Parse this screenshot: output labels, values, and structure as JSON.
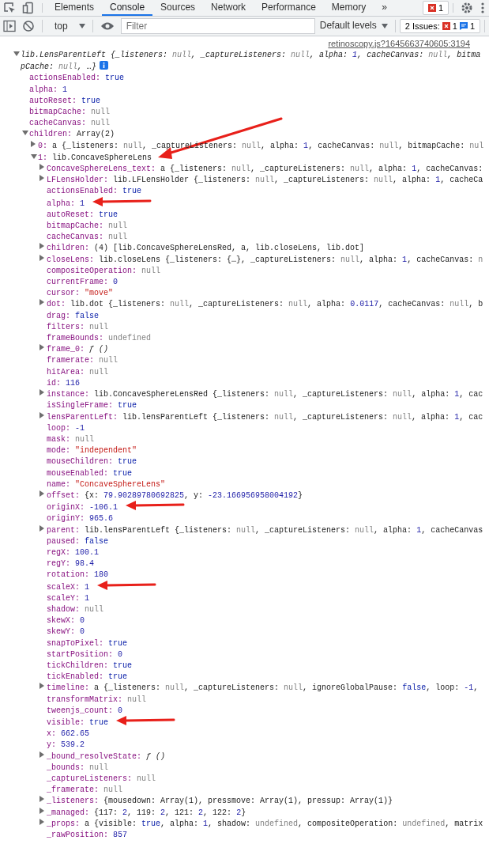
{
  "tabs": [
    {
      "label": "Elements",
      "selected": false
    },
    {
      "label": "Console",
      "selected": true
    },
    {
      "label": "Sources",
      "selected": false
    },
    {
      "label": "Network",
      "selected": false
    },
    {
      "label": "Performance",
      "selected": false
    },
    {
      "label": "Memory",
      "selected": false
    }
  ],
  "more_tabs": "»",
  "error_badge": {
    "count": "1"
  },
  "console_toolbar": {
    "context": "top",
    "filter_placeholder": "Filter",
    "levels": "Default levels",
    "issues": {
      "label": "2 Issues:",
      "errors": "1",
      "infos": "1"
    }
  },
  "source_link": "retinoscopy.js?1645663740605:3194",
  "root": {
    "expanded": true,
    "info_badge": true,
    "preview_lines": [
      [
        {
          "text": "lib.LensParentLeft {_listeners: ",
          "kind": "plain"
        },
        {
          "text": "null",
          "kind": "null"
        },
        {
          "text": ", _captureListeners: ",
          "kind": "plain"
        },
        {
          "text": "null",
          "kind": "null"
        },
        {
          "text": ", alpha: ",
          "kind": "plain"
        },
        {
          "text": "1",
          "kind": "number"
        },
        {
          "text": ", cacheCanvas: ",
          "kind": "plain"
        },
        {
          "text": "null",
          "kind": "null"
        },
        {
          "text": ", bitma",
          "kind": "plain"
        }
      ],
      [
        {
          "text": "pCache: ",
          "kind": "plain"
        },
        {
          "text": "null",
          "kind": "null"
        },
        {
          "text": ", …}",
          "kind": "plain"
        }
      ]
    ],
    "children": [
      {
        "key": "actionsEnabled:",
        "value": "true",
        "kind": "bool"
      },
      {
        "key": "alpha:",
        "value": "1",
        "kind": "number"
      },
      {
        "key": "autoReset:",
        "value": "true",
        "kind": "bool"
      },
      {
        "key": "bitmapCache:",
        "value": "null",
        "kind": "null"
      },
      {
        "key": "cacheCanvas:",
        "value": "null",
        "kind": "null"
      },
      {
        "key": "children:",
        "value": "Array(2)",
        "kind": "plain",
        "expanded": true,
        "children": [
          {
            "key": "0:",
            "expanded": false,
            "parts": [
              {
                "text": "a {_listeners: ",
                "kind": "plain"
              },
              {
                "text": "null",
                "kind": "null"
              },
              {
                "text": ", _captureListeners: ",
                "kind": "plain"
              },
              {
                "text": "null",
                "kind": "null"
              },
              {
                "text": ", alpha: ",
                "kind": "plain"
              },
              {
                "text": "1",
                "kind": "number"
              },
              {
                "text": ", cacheCanvas: ",
                "kind": "plain"
              },
              {
                "text": "null",
                "kind": "null"
              },
              {
                "text": ", bitmapCache: ",
                "kind": "plain"
              },
              {
                "text": "nul",
                "kind": "null"
              }
            ]
          },
          {
            "key": "1:",
            "value": "lib.ConcaveSphereLens",
            "kind": "plain",
            "expanded": true,
            "arrow": true,
            "arrow_slanted": true,
            "children": [
              {
                "key": "ConcaveSphereLens_text:",
                "expanded": false,
                "parts": [
                  {
                    "text": "a {_listeners: ",
                    "kind": "plain"
                  },
                  {
                    "text": "null",
                    "kind": "null"
                  },
                  {
                    "text": ", _captureListeners: ",
                    "kind": "plain"
                  },
                  {
                    "text": "null",
                    "kind": "null"
                  },
                  {
                    "text": ", alpha: ",
                    "kind": "plain"
                  },
                  {
                    "text": "1",
                    "kind": "number"
                  },
                  {
                    "text": ", cacheCanvas:",
                    "kind": "plain"
                  }
                ]
              },
              {
                "key": "LFLensHolder:",
                "expanded": false,
                "parts": [
                  {
                    "text": "lib.LFLensHolder {_listeners: ",
                    "kind": "plain"
                  },
                  {
                    "text": "null",
                    "kind": "null"
                  },
                  {
                    "text": ", _captureListeners: ",
                    "kind": "plain"
                  },
                  {
                    "text": "null",
                    "kind": "null"
                  },
                  {
                    "text": ", alpha: ",
                    "kind": "plain"
                  },
                  {
                    "text": "1",
                    "kind": "number"
                  },
                  {
                    "text": ", cacheCa",
                    "kind": "plain"
                  }
                ]
              },
              {
                "key": "actionsEnabled:",
                "value": "true",
                "kind": "bool"
              },
              {
                "key": "alpha:",
                "value": "1",
                "kind": "number",
                "arrow": true
              },
              {
                "key": "autoReset:",
                "value": "true",
                "kind": "bool"
              },
              {
                "key": "bitmapCache:",
                "value": "null",
                "kind": "null"
              },
              {
                "key": "cacheCanvas:",
                "value": "null",
                "kind": "null"
              },
              {
                "key": "children:",
                "expanded": false,
                "parts": [
                  {
                    "text": "(4) [lib.ConcaveSphereLensRed, a, lib.closeLens, lib.dot]",
                    "kind": "plain"
                  }
                ]
              },
              {
                "key": "closeLens:",
                "expanded": false,
                "parts": [
                  {
                    "text": "lib.closeLens {_listeners: {…}, _captureListeners: ",
                    "kind": "plain"
                  },
                  {
                    "text": "null",
                    "kind": "null"
                  },
                  {
                    "text": ", alpha: ",
                    "kind": "plain"
                  },
                  {
                    "text": "1",
                    "kind": "number"
                  },
                  {
                    "text": ", cacheCanvas: ",
                    "kind": "plain"
                  },
                  {
                    "text": "n",
                    "kind": "null"
                  }
                ]
              },
              {
                "key": "compositeOperation:",
                "value": "null",
                "kind": "null"
              },
              {
                "key": "currentFrame:",
                "value": "0",
                "kind": "number"
              },
              {
                "key": "cursor:",
                "value": "\"move\"",
                "kind": "string"
              },
              {
                "key": "dot:",
                "expanded": false,
                "parts": [
                  {
                    "text": "lib.dot {_listeners: ",
                    "kind": "plain"
                  },
                  {
                    "text": "null",
                    "kind": "null"
                  },
                  {
                    "text": ", _captureListeners: ",
                    "kind": "plain"
                  },
                  {
                    "text": "null",
                    "kind": "null"
                  },
                  {
                    "text": ", alpha: ",
                    "kind": "plain"
                  },
                  {
                    "text": "0.0117",
                    "kind": "number"
                  },
                  {
                    "text": ", cacheCanvas: ",
                    "kind": "plain"
                  },
                  {
                    "text": "null",
                    "kind": "null"
                  },
                  {
                    "text": ", b",
                    "kind": "plain"
                  }
                ]
              },
              {
                "key": "drag:",
                "value": "false",
                "kind": "bool"
              },
              {
                "key": "filters:",
                "value": "null",
                "kind": "null"
              },
              {
                "key": "frameBounds:",
                "value": "undefined",
                "kind": "null"
              },
              {
                "key": "frame_0:",
                "value": "ƒ ()",
                "kind": "func",
                "expanded": false
              },
              {
                "key": "framerate:",
                "value": "null",
                "kind": "null"
              },
              {
                "key": "hitArea:",
                "value": "null",
                "kind": "null"
              },
              {
                "key": "id:",
                "value": "116",
                "kind": "number"
              },
              {
                "key": "instance:",
                "expanded": false,
                "parts": [
                  {
                    "text": "lib.ConcaveSphereLensRed {_listeners: ",
                    "kind": "plain"
                  },
                  {
                    "text": "null",
                    "kind": "null"
                  },
                  {
                    "text": ", _captureListeners: ",
                    "kind": "plain"
                  },
                  {
                    "text": "null",
                    "kind": "null"
                  },
                  {
                    "text": ", alpha: ",
                    "kind": "plain"
                  },
                  {
                    "text": "1",
                    "kind": "number"
                  },
                  {
                    "text": ", cac",
                    "kind": "plain"
                  }
                ]
              },
              {
                "key": "isSingleFrame:",
                "value": "true",
                "kind": "bool"
              },
              {
                "key": "lensParentLeft:",
                "expanded": false,
                "parts": [
                  {
                    "text": "lib.lensParentLeft {_listeners: ",
                    "kind": "plain"
                  },
                  {
                    "text": "null",
                    "kind": "null"
                  },
                  {
                    "text": ", _captureListeners: ",
                    "kind": "plain"
                  },
                  {
                    "text": "null",
                    "kind": "null"
                  },
                  {
                    "text": ", alpha: ",
                    "kind": "plain"
                  },
                  {
                    "text": "1",
                    "kind": "number"
                  },
                  {
                    "text": ", cac",
                    "kind": "plain"
                  }
                ]
              },
              {
                "key": "loop:",
                "value": "-1",
                "kind": "number"
              },
              {
                "key": "mask:",
                "value": "null",
                "kind": "null"
              },
              {
                "key": "mode:",
                "value": "\"independent\"",
                "kind": "string"
              },
              {
                "key": "mouseChildren:",
                "value": "true",
                "kind": "bool"
              },
              {
                "key": "mouseEnabled:",
                "value": "true",
                "kind": "bool"
              },
              {
                "key": "name:",
                "value": "\"ConcaveSphereLens\"",
                "kind": "string"
              },
              {
                "key": "offset:",
                "expanded": false,
                "parts": [
                  {
                    "text": "{x: ",
                    "kind": "plain"
                  },
                  {
                    "text": "79.90289780692825",
                    "kind": "number"
                  },
                  {
                    "text": ", y: ",
                    "kind": "plain"
                  },
                  {
                    "text": "-23.166956958004192",
                    "kind": "number"
                  },
                  {
                    "text": "}",
                    "kind": "plain"
                  }
                ]
              },
              {
                "key": "originX:",
                "value": "-106.1",
                "kind": "number",
                "arrow": true
              },
              {
                "key": "originY:",
                "value": "965.6",
                "kind": "number"
              },
              {
                "key": "parent:",
                "expanded": false,
                "parts": [
                  {
                    "text": "lib.lensParentLeft {_listeners: ",
                    "kind": "plain"
                  },
                  {
                    "text": "null",
                    "kind": "null"
                  },
                  {
                    "text": ", _captureListeners: ",
                    "kind": "plain"
                  },
                  {
                    "text": "null",
                    "kind": "null"
                  },
                  {
                    "text": ", alpha: ",
                    "kind": "plain"
                  },
                  {
                    "text": "1",
                    "kind": "number"
                  },
                  {
                    "text": ", cacheCanvas",
                    "kind": "plain"
                  }
                ]
              },
              {
                "key": "paused:",
                "value": "false",
                "kind": "bool"
              },
              {
                "key": "regX:",
                "value": "100.1",
                "kind": "number"
              },
              {
                "key": "regY:",
                "value": "98.4",
                "kind": "number"
              },
              {
                "key": "rotation:",
                "value": "180",
                "kind": "number"
              },
              {
                "key": "scaleX:",
                "value": "1",
                "kind": "number",
                "arrow": true
              },
              {
                "key": "scaleY:",
                "value": "1",
                "kind": "number"
              },
              {
                "key": "shadow:",
                "value": "null",
                "kind": "null"
              },
              {
                "key": "skewX:",
                "value": "0",
                "kind": "number"
              },
              {
                "key": "skewY:",
                "value": "0",
                "kind": "number"
              },
              {
                "key": "snapToPixel:",
                "value": "true",
                "kind": "bool"
              },
              {
                "key": "startPosition:",
                "value": "0",
                "kind": "number"
              },
              {
                "key": "tickChildren:",
                "value": "true",
                "kind": "bool"
              },
              {
                "key": "tickEnabled:",
                "value": "true",
                "kind": "bool"
              },
              {
                "key": "timeline:",
                "expanded": false,
                "parts": [
                  {
                    "text": "a {_listeners: ",
                    "kind": "plain"
                  },
                  {
                    "text": "null",
                    "kind": "null"
                  },
                  {
                    "text": ", _captureListeners: ",
                    "kind": "plain"
                  },
                  {
                    "text": "null",
                    "kind": "null"
                  },
                  {
                    "text": ", ignoreGlobalPause: ",
                    "kind": "plain"
                  },
                  {
                    "text": "false",
                    "kind": "bool"
                  },
                  {
                    "text": ", loop: ",
                    "kind": "plain"
                  },
                  {
                    "text": "-1",
                    "kind": "number"
                  },
                  {
                    "text": ",",
                    "kind": "plain"
                  }
                ]
              },
              {
                "key": "transformMatrix:",
                "value": "null",
                "kind": "null"
              },
              {
                "key": "tweenjs_count:",
                "value": "0",
                "kind": "number"
              },
              {
                "key": "visible:",
                "value": "true",
                "kind": "bool",
                "arrow": true
              },
              {
                "key": "x:",
                "value": "662.65",
                "kind": "number"
              },
              {
                "key": "y:",
                "value": "539.2",
                "kind": "number"
              },
              {
                "key": "_bound_resolveState:",
                "value": "ƒ ()",
                "kind": "func",
                "expanded": false
              },
              {
                "key": "_bounds:",
                "value": "null",
                "kind": "null"
              },
              {
                "key": "_captureListeners:",
                "value": "null",
                "kind": "null"
              },
              {
                "key": "_framerate:",
                "value": "null",
                "kind": "null"
              },
              {
                "key": "_listeners:",
                "expanded": false,
                "parts": [
                  {
                    "text": "{mousedown: Array(1), pressmove: Array(1), pressup: Array(1)}",
                    "kind": "plain"
                  }
                ]
              },
              {
                "key": "_managed:",
                "expanded": false,
                "parts": [
                  {
                    "text": "{117: ",
                    "kind": "plain"
                  },
                  {
                    "text": "2",
                    "kind": "number"
                  },
                  {
                    "text": ", 119: ",
                    "kind": "plain"
                  },
                  {
                    "text": "2",
                    "kind": "number"
                  },
                  {
                    "text": ", 121: ",
                    "kind": "plain"
                  },
                  {
                    "text": "2",
                    "kind": "number"
                  },
                  {
                    "text": ", 122: ",
                    "kind": "plain"
                  },
                  {
                    "text": "2",
                    "kind": "number"
                  },
                  {
                    "text": "}",
                    "kind": "plain"
                  }
                ]
              },
              {
                "key": "_props:",
                "expanded": false,
                "parts": [
                  {
                    "text": "a {visible: ",
                    "kind": "plain"
                  },
                  {
                    "text": "true",
                    "kind": "bool"
                  },
                  {
                    "text": ", alpha: ",
                    "kind": "plain"
                  },
                  {
                    "text": "1",
                    "kind": "number"
                  },
                  {
                    "text": ", shadow: ",
                    "kind": "plain"
                  },
                  {
                    "text": "undefined",
                    "kind": "null"
                  },
                  {
                    "text": ", compositeOperation: ",
                    "kind": "plain"
                  },
                  {
                    "text": "undefined",
                    "kind": "null"
                  },
                  {
                    "text": ", matrix",
                    "kind": "plain"
                  }
                ]
              },
              {
                "key": "_rawPosition:",
                "value": "857",
                "kind": "number"
              }
            ]
          }
        ]
      }
    ]
  }
}
